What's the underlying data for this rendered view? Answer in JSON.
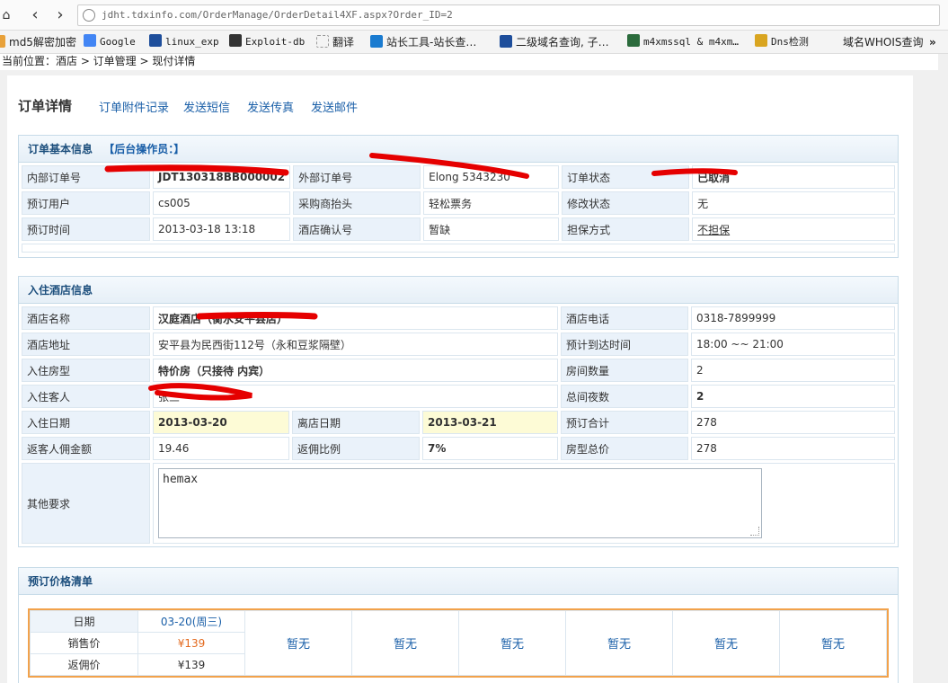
{
  "browser": {
    "url": "jdht.tdxinfo.com/OrderManage/OrderDetail4XF.aspx?Order_ID=2",
    "back_icon": "chevron-left",
    "forward_icon": "chevron-right"
  },
  "bookmarks": [
    {
      "label": "md5解密加密",
      "icon": "folder-icon",
      "color": "#e8a13a"
    },
    {
      "label": "Google",
      "icon": "google-icon",
      "color": "#4285f4"
    },
    {
      "label": "linux_exp",
      "icon": "s-icon",
      "color": "#1e4e9b"
    },
    {
      "label": "Exploit-db",
      "icon": "exploit-icon",
      "color": "#333333"
    },
    {
      "label": "翻译",
      "icon": "page-icon",
      "color": "#999999"
    },
    {
      "label": "站长工具-站长查…",
      "icon": "chinaz-icon",
      "color": "#1a7bd0"
    },
    {
      "label": "二级域名查询, 子…",
      "icon": "arrow-icon",
      "color": "#1e4e9b"
    },
    {
      "label": "m4xmssql & m4xm…",
      "icon": "x-icon",
      "color": "#2b6b3c"
    },
    {
      "label": "Dns检测",
      "icon": "dns-icon",
      "color": "#d9a520"
    },
    {
      "label": "域名WHOIS查询",
      "icon": "",
      "color": ""
    }
  ],
  "breadcrumb": "当前位置：酒店 > 订单管理 > 现付详情",
  "header": {
    "title": "订单详情",
    "tabs": [
      "订单附件记录",
      "发送短信",
      "发送传真",
      "发送邮件"
    ]
  },
  "basic": {
    "title": "订单基本信息",
    "operator": "【后台操作员：】",
    "rows": [
      [
        {
          "l": "内部订单号",
          "v": "JDT130318BB000002"
        },
        {
          "l": "外部订单号",
          "v": "Elong  5343230"
        },
        {
          "l": "订单状态",
          "v": "已取消"
        }
      ],
      [
        {
          "l": "预订用户",
          "v": "cs005"
        },
        {
          "l": "采购商抬头",
          "v": "轻松票务"
        },
        {
          "l": "修改状态",
          "v": "无"
        }
      ],
      [
        {
          "l": "预订时间",
          "v": "2013-03-18 13:18"
        },
        {
          "l": "酒店确认号",
          "v": "暂缺"
        },
        {
          "l": "担保方式",
          "v": "不担保"
        }
      ]
    ]
  },
  "hotel": {
    "title": "入住酒店信息",
    "name_label": "酒店名称",
    "name": "汉庭酒店（衡水安平县店）",
    "phone_label": "酒店电话",
    "phone": "0318-7899999",
    "addr_label": "酒店地址",
    "addr": "安平县为民西街112号（永和豆浆隔壁）",
    "arrive_label": "预计到达时间",
    "arrive": "18:00 ~~ 21:00",
    "room_label": "入住房型",
    "room": "特价房（只接待 内宾）",
    "count_label": "房间数量",
    "count": "2",
    "guest_label": "入住客人",
    "guest": "张三",
    "nights_label": "总间夜数",
    "nights": "2",
    "checkin_label": "入住日期",
    "checkin": "2013-03-20",
    "checkout_label": "离店日期",
    "checkout": "2013-03-21",
    "total_label": "预订合计",
    "total": "278",
    "rebate_label": "返客人佣金额",
    "rebate": "19.46",
    "ratio_label": "返佣比例",
    "ratio": "7%",
    "roomtotal_label": "房型总价",
    "roomtotal": "278",
    "other_label": "其他要求",
    "other": "hemax"
  },
  "price": {
    "title": "预订价格清单",
    "date_label": "日期",
    "date": "03-20(周三)",
    "sale_label": "销售价",
    "sale": "¥139",
    "rebate_label": "返佣价",
    "rebate": "¥139",
    "none": "暂无"
  }
}
